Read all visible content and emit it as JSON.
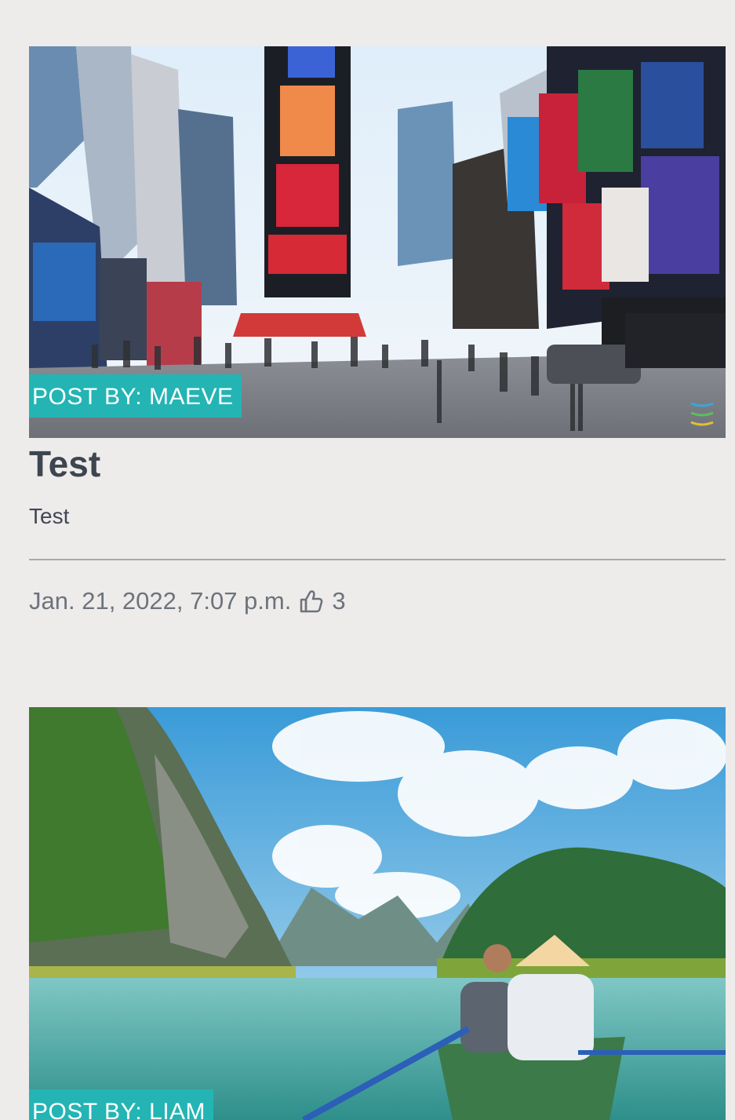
{
  "posts": [
    {
      "author_label": "POST BY: MAEVE",
      "title": "Test",
      "excerpt": "Test",
      "date": "Jan. 21, 2022, 7:07 p.m.",
      "likes": "3",
      "image_subject": "city-billboards-street-photo"
    },
    {
      "author_label": "POST BY: LIAM",
      "image_subject": "river-boat-karst-mountains-photo"
    }
  ],
  "colors": {
    "background": "#eeebeb",
    "badge": "#24b4b4",
    "title": "#3d4550",
    "meta": "#6d737b",
    "divider": "#a9a9ab"
  },
  "icons": [
    "thumbs-up-icon",
    "menu-lines-icon"
  ]
}
